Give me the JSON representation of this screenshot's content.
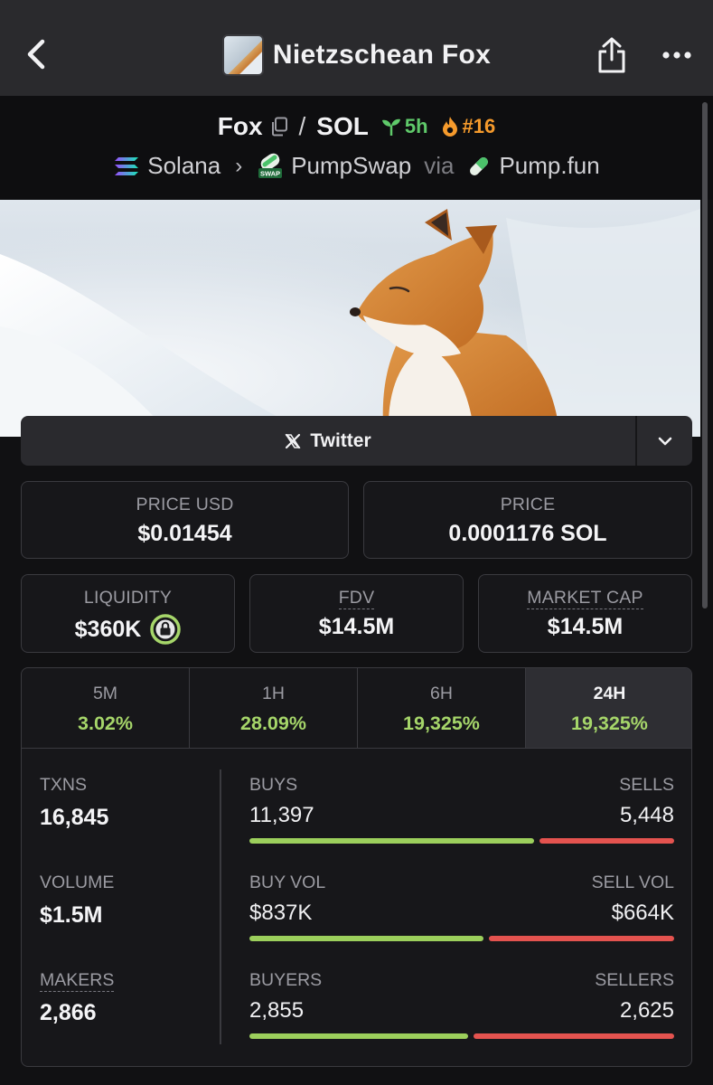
{
  "nav": {
    "title": "Nietzschean Fox"
  },
  "pair": {
    "base": "Fox",
    "separator": "/",
    "quote": "SOL",
    "age": "5h",
    "rank": "#16",
    "chain": "Solana",
    "dex": "PumpSwap",
    "via_text": "via",
    "launchpad": "Pump.fun",
    "dex_icon_text": "SWAP"
  },
  "social": {
    "twitter_label": "Twitter"
  },
  "stats": {
    "price_usd_label": "PRICE USD",
    "price_usd": "$0.01454",
    "price_label": "PRICE",
    "price_native": "0.0001176 SOL",
    "liquidity_label": "LIQUIDITY",
    "liquidity": "$360K",
    "fdv_label": "FDV",
    "fdv": "$14.5M",
    "mcap_label": "MARKET CAP",
    "mcap": "$14.5M"
  },
  "timeframes": [
    {
      "label": "5M",
      "change": "3.02%"
    },
    {
      "label": "1H",
      "change": "28.09%"
    },
    {
      "label": "6H",
      "change": "19,325%"
    },
    {
      "label": "24H",
      "change": "19,325%",
      "active": true
    }
  ],
  "txns": {
    "txns_label": "TXNS",
    "txns": "16,845",
    "volume_label": "VOLUME",
    "volume": "$1.5M",
    "makers_label": "MAKERS",
    "makers": "2,866",
    "buys_label": "BUYS",
    "buys": "11,397",
    "sells_label": "SELLS",
    "sells": "5,448",
    "buys_ratio": 0.677,
    "buy_vol_label": "BUY VOL",
    "buy_vol": "$837K",
    "sell_vol_label": "SELL VOL",
    "sell_vol": "$664K",
    "buy_vol_ratio": 0.558,
    "buyers_label": "BUYERS",
    "buyers": "2,855",
    "sellers_label": "SELLERS",
    "sellers": "2,625",
    "buyers_ratio": 0.521
  },
  "colors": {
    "positive": "#a6d66a",
    "buy_bar": "#9ccf5c",
    "sell_bar": "#e4534f",
    "age_green": "#5fc96a",
    "rank_orange": "#f59a2c"
  }
}
